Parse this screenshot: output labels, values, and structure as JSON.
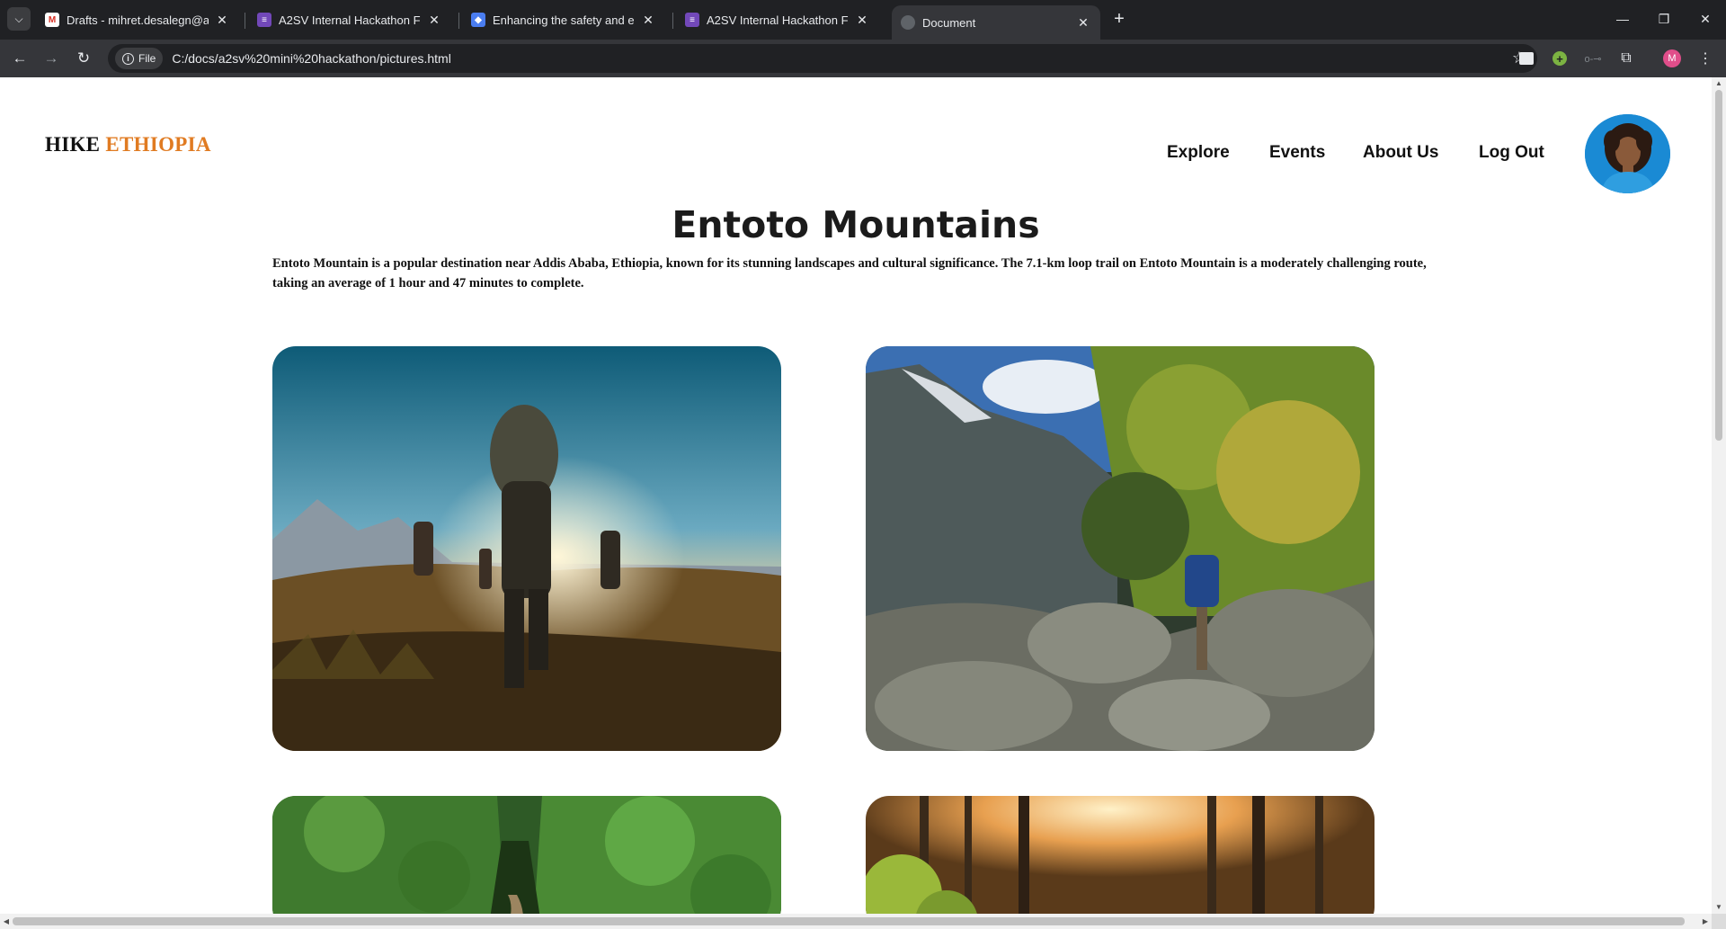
{
  "browser": {
    "tabs": [
      {
        "title": "Drafts - mihret.desalegn@a2sv",
        "favicon": "gmail-icon"
      },
      {
        "title": "A2SV Internal Hackathon Final (",
        "favicon": "forms-icon"
      },
      {
        "title": "Enhancing the safety and enjoy",
        "favicon": "shield-icon"
      },
      {
        "title": "A2SV Internal Hackathon Final (",
        "favicon": "forms-icon"
      },
      {
        "title": "Document",
        "favicon": "globe-icon"
      }
    ],
    "active_tab": 4,
    "address": {
      "chip_label": "File",
      "url": "C:/docs/a2sv%20mini%20hackathon/pictures.html"
    },
    "profile_initial": "M"
  },
  "site": {
    "logo_part1": "HIKE",
    "logo_part2": "ETHIOPIA",
    "nav": [
      "Explore",
      "Events",
      "About Us",
      "Log Out"
    ],
    "brand_accent": "#e07b22"
  },
  "page": {
    "heading": "Entoto Mountains",
    "description": "Entoto Mountain is a popular destination near Addis Ababa, Ethiopia, known for its stunning landscapes and cultural significance. The 7.1-km loop trail on Entoto Mountain is a moderately challenging route, taking an average of 1 hour and 47 minutes to complete.",
    "gallery": [
      {
        "scene": "hikers-walking-at-sunset-photo"
      },
      {
        "scene": "hiker-climbing-rocky-mountain-photo"
      },
      {
        "scene": "green-forest-trail-photo"
      },
      {
        "scene": "sunlit-pine-forest-photo"
      }
    ]
  }
}
